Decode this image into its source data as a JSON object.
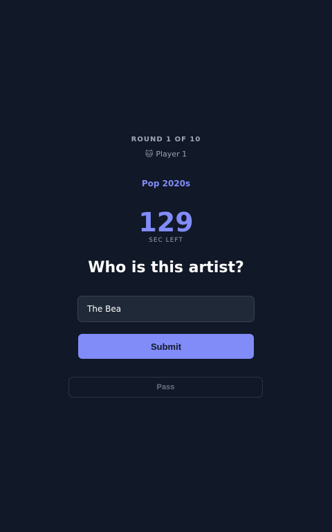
{
  "round": {
    "label": "ROUND 1 OF 10"
  },
  "player": {
    "avatar": "🐱",
    "name": "Player 1"
  },
  "category": {
    "name": "Pop 2020s"
  },
  "timer": {
    "seconds": "129",
    "label": "SEC LEFT"
  },
  "question": {
    "text": "Who is this artist?"
  },
  "answer": {
    "value": "The Bea",
    "placeholder": ""
  },
  "actions": {
    "submit_label": "Submit",
    "pass_label": "Pass"
  },
  "colors": {
    "background": "#111827",
    "accent": "#818cf8",
    "input_bg": "#1f2937"
  }
}
